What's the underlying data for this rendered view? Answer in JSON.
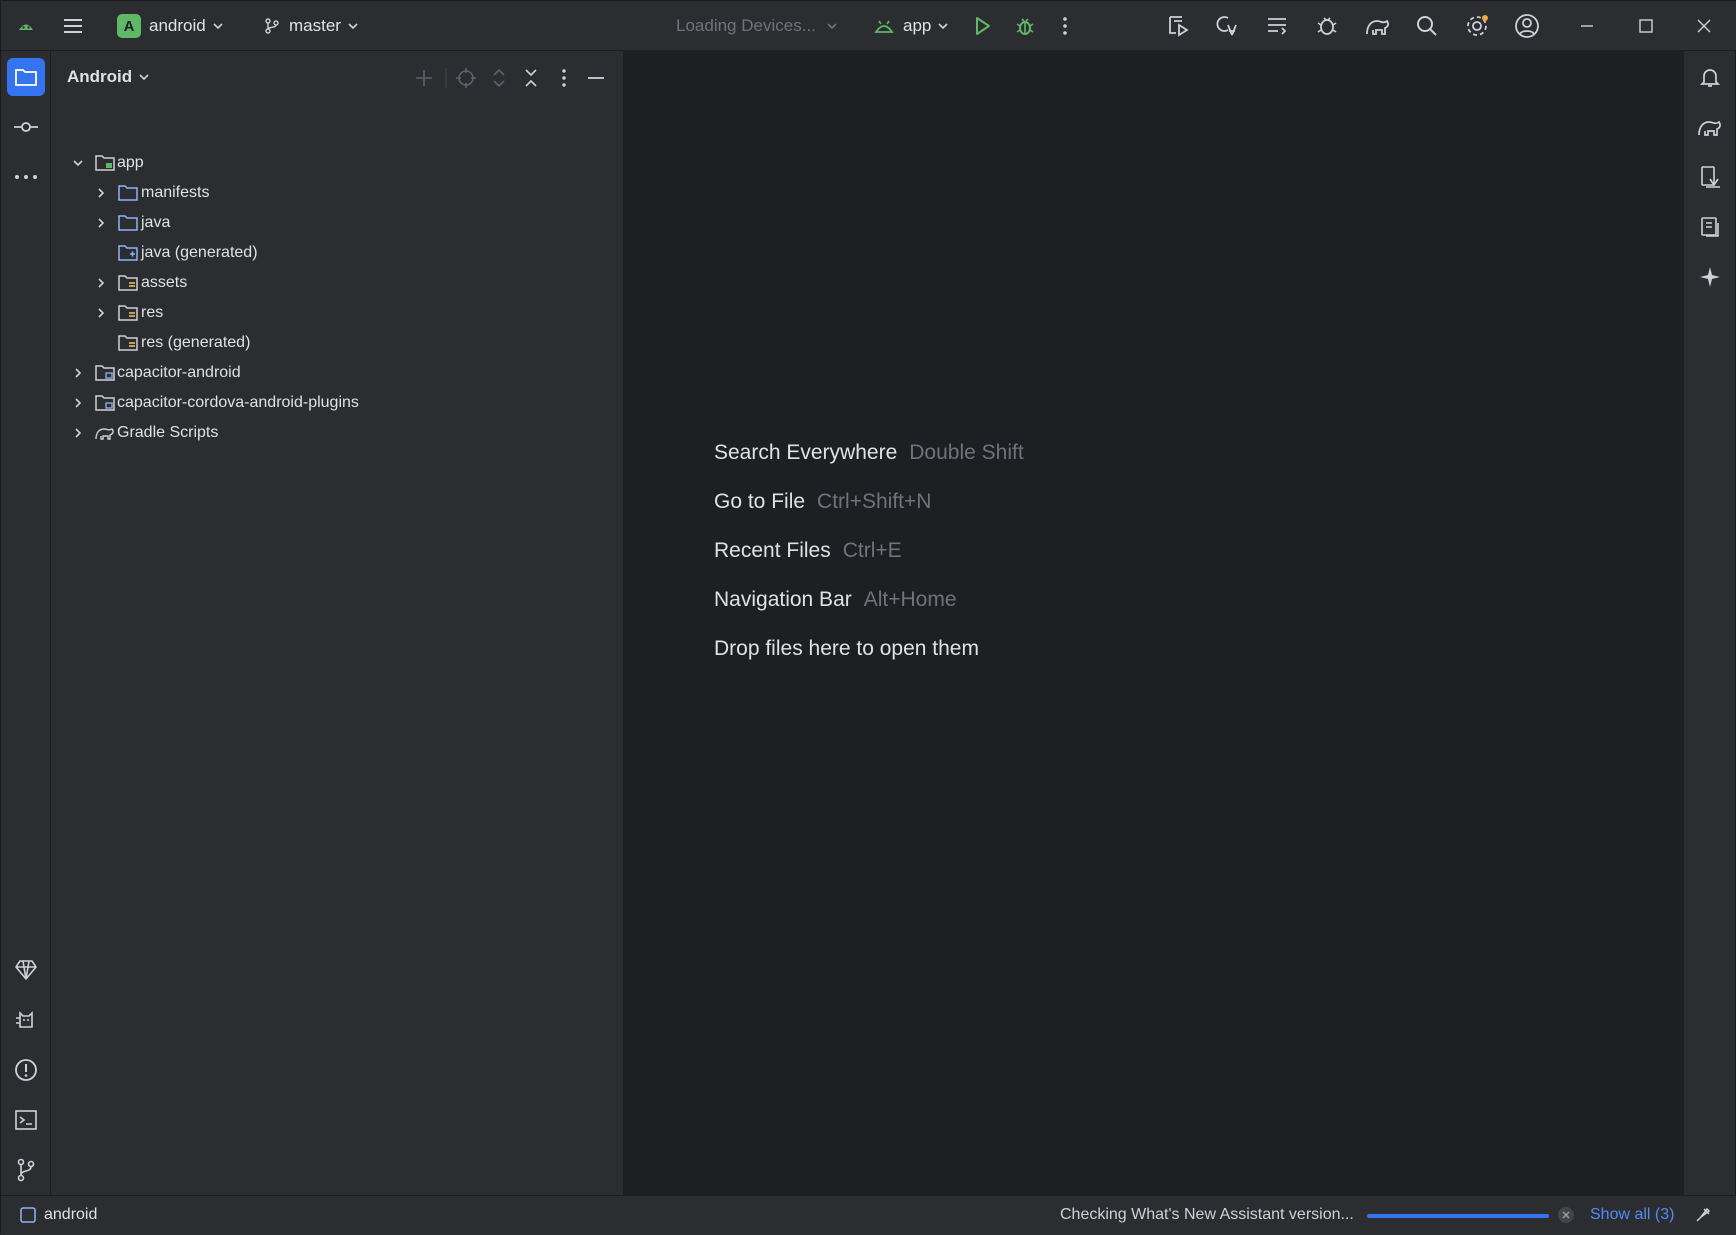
{
  "titlebar": {
    "project_name": "android",
    "project_badge": "A",
    "branch": "master",
    "devices": "Loading Devices...",
    "run_config": "app"
  },
  "project_panel": {
    "title": "Android",
    "tree": [
      {
        "label": "app",
        "level": 0,
        "expanded": true
      },
      {
        "label": "manifests",
        "level": 1,
        "expanded": false
      },
      {
        "label": "java",
        "level": 1,
        "expanded": false
      },
      {
        "label": "java (generated)",
        "level": 1
      },
      {
        "label": "assets",
        "level": 1,
        "expanded": false
      },
      {
        "label": "res",
        "level": 1,
        "expanded": false
      },
      {
        "label": "res (generated)",
        "level": 1
      },
      {
        "label": "capacitor-android",
        "level": 0,
        "expanded": false
      },
      {
        "label": "capacitor-cordova-android-plugins",
        "level": 0,
        "expanded": false
      },
      {
        "label": "Gradle Scripts",
        "level": 0,
        "expanded": false
      }
    ]
  },
  "editor": {
    "hints": [
      {
        "label": "Search Everywhere",
        "shortcut": "Double Shift"
      },
      {
        "label": "Go to File",
        "shortcut": "Ctrl+Shift+N"
      },
      {
        "label": "Recent Files",
        "shortcut": "Ctrl+E"
      },
      {
        "label": "Navigation Bar",
        "shortcut": "Alt+Home"
      },
      {
        "label": "Drop files here to open them",
        "shortcut": ""
      }
    ]
  },
  "statusbar": {
    "module": "android",
    "task": "Checking What's New Assistant version...",
    "progress": 1.0,
    "show_all": "Show all (3)"
  },
  "colors": {
    "accent": "#3574f0",
    "run_green": "#5fb865",
    "background": "#2b2d30",
    "editor_background": "#1e1f22"
  }
}
